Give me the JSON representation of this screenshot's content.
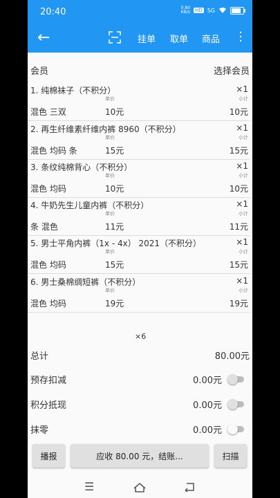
{
  "status": {
    "time": "20:40",
    "net_top": "0.80",
    "net_bottom": "KB/s",
    "hd": "HD",
    "signal": "5G"
  },
  "toolbar": {
    "hang_order": "挂单",
    "take_order": "取单",
    "products": "商品"
  },
  "member": {
    "label": "会员",
    "select": "选择会员"
  },
  "labels": {
    "unit_price": "单价",
    "subtotal": "小计"
  },
  "items": [
    {
      "name": "1.  纯棉袜子（不积分）",
      "qty": "×1",
      "spec": "混色 三双",
      "price": "10元",
      "subtotal": "10元"
    },
    {
      "name": "2.  再生纤维素纤维内裤 8960（不积分）",
      "qty": "×1",
      "spec": "混色 均码 条",
      "price": "15元",
      "subtotal": "15元"
    },
    {
      "name": "3.  条纹纯棉背心（不积分）",
      "qty": "×1",
      "spec": "混色 均码",
      "price": "10元",
      "subtotal": "10元"
    },
    {
      "name": "4.  牛奶先生儿童内裤（不积分）",
      "qty": "×1",
      "spec": "条 混色",
      "price": "11元",
      "subtotal": "11元"
    },
    {
      "name": "5.  男士平角内裤（1x - 4x） 2021（不积分）",
      "qty": "×1",
      "spec": "混色 均码",
      "price": "15元",
      "subtotal": "15元"
    },
    {
      "name": "6.  男士桑棉绸短裤（不积分）",
      "qty": "×1",
      "spec": "混色 均码",
      "price": "19元",
      "subtotal": "19元"
    }
  ],
  "count": "×6",
  "summary": {
    "total_label": "总计",
    "total_value": "80.00元",
    "deposit_label": "预存扣减",
    "deposit_value": "0.00元",
    "points_label": "积分抵现",
    "points_value": "0.00元",
    "round_label": "抹零",
    "round_value": "0.00元"
  },
  "actions": {
    "announce": "播报",
    "checkout": "应收 80.00 元，结账...",
    "scan": "扫描"
  }
}
